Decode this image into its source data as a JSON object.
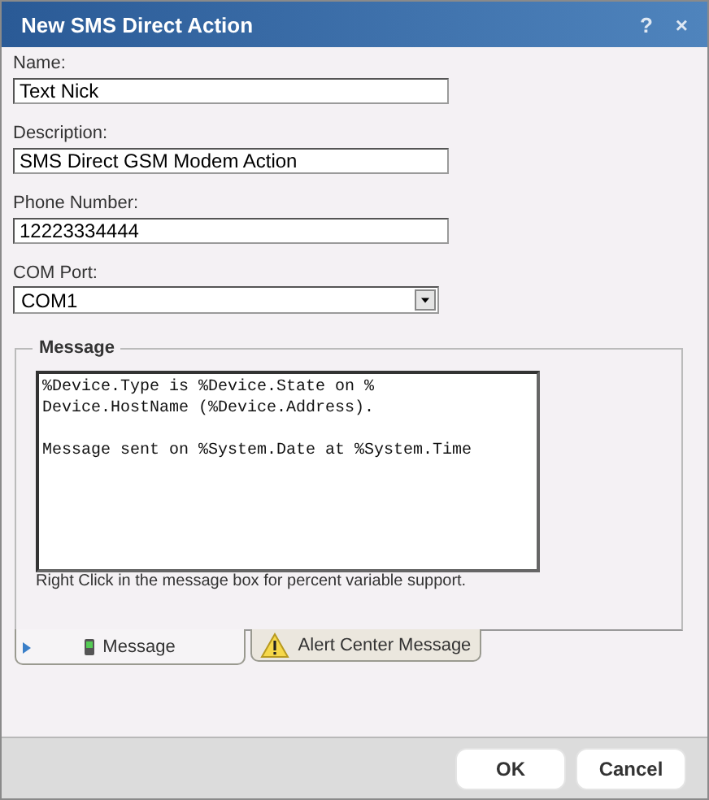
{
  "window": {
    "title": "New SMS Direct Action",
    "help": "?",
    "close": "×"
  },
  "fields": [
    {
      "label": "Name:",
      "value": "Text Nick",
      "kind": "text"
    },
    {
      "label": "Description:",
      "value": "SMS Direct GSM Modem Action",
      "kind": "text"
    },
    {
      "label": "Phone Number:",
      "value": "12223334444",
      "kind": "text"
    },
    {
      "label": "COM Port:",
      "value": "COM1",
      "kind": "select"
    }
  ],
  "message_group": {
    "title": "Message",
    "message": "%Device.Type is %Device.State on %\nDevice.HostName (%Device.Address).\n\nMessage sent on %System.Date at %System.Time",
    "hint": "Right Click in the message box for percent variable support."
  },
  "tabs": [
    {
      "label": "Message",
      "selected": true,
      "kind": "phone"
    },
    {
      "label": "Alert Center Message",
      "selected": false,
      "kind": "warning"
    }
  ],
  "buttons": [
    "OK",
    "Cancel"
  ]
}
